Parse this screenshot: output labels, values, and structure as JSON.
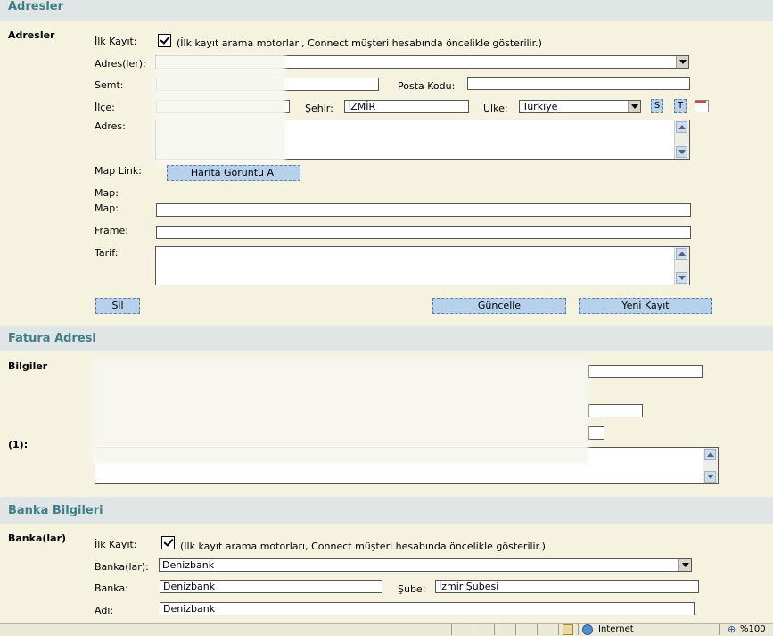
{
  "sections": {
    "addresses": "Adresler",
    "billing": "Fatura Adresi",
    "bank": "Banka Bilgileri"
  },
  "addresses": {
    "group_label": "Adresler",
    "first_record_label": "İlk Kayıt:",
    "first_record_note": "(İlk kayıt arama motorları, Connect müşteri hesabında öncelikle gösterilir.)",
    "addresses_label": "Adres(ler):",
    "district_label": "Semt:",
    "postal_code_label": "Posta Kodu:",
    "county_label": "İlçe:",
    "city_label": "Şehir:",
    "city_value": "İZMİR",
    "country_label": "Ülke:",
    "country_value": "Türkiye",
    "s_button": "S",
    "t_button": "T",
    "address_label": "Adres:",
    "map_link_label": "Map Link:",
    "map_button": "Harita Görüntü Al",
    "map_label_1": "Map:",
    "map_label_2": "Map:",
    "frame_label": "Frame:",
    "description_label": "Tarif:",
    "delete_button": "Sil",
    "update_button": "Güncelle",
    "new_record_button": "Yeni Kayıt"
  },
  "billing": {
    "info_label": "Bilgiler",
    "index_label": "(1):"
  },
  "bank": {
    "group_label": "Banka(lar)",
    "first_record_label": "İlk Kayıt:",
    "first_record_note": "(İlk kayıt arama motorları, Connect müşteri hesabında öncelikle gösterilir.)",
    "banks_label": "Banka(lar):",
    "banks_value": "Denizbank",
    "bank_label": "Banka:",
    "bank_value": "Denizbank",
    "branch_label": "Şube:",
    "branch_value": "İzmir Şubesi",
    "name_label": "Adı:",
    "name_value": "Denizbank"
  },
  "statusbar": {
    "zone": "Internet",
    "zoom": "%100"
  }
}
